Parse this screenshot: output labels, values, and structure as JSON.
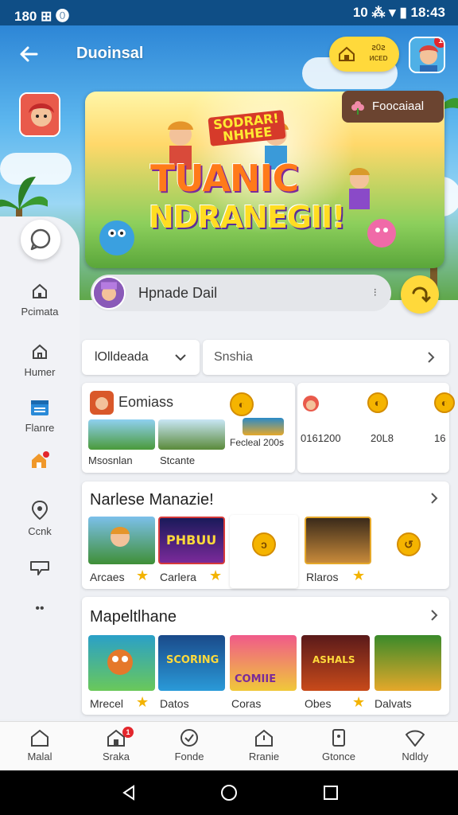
{
  "status_bar": {
    "left": "180 ⊞ ⓿",
    "right": "10 ⁂ ▾ ▮ 18:43"
  },
  "header": {
    "title": "Duoinsal",
    "coins_text": "ꙅ0ꙅ\nᴎᴄᴇᴅ",
    "notification_count": "1"
  },
  "banner": {
    "title": "TUANIC",
    "subtitle": "NDRANEGII!",
    "tag": "SODRAR!\nNHHEE",
    "promo_label": "Foocaiaal"
  },
  "rail": {
    "items": [
      "Pcimata",
      "Humer",
      "Flanre",
      "",
      "Ccnk",
      "",
      "••"
    ]
  },
  "search": {
    "text": "Hpnade Dail",
    "chevron": "⁝"
  },
  "filters": {
    "dropdown": "lOlldeada",
    "search_placeholder": "Snshia"
  },
  "featured": {
    "title": "Eomiass",
    "items": [
      {
        "label": "Msosnlan"
      },
      {
        "label": "Stcante"
      },
      {
        "label": "Fecleal 200ꜱ"
      }
    ],
    "side": {
      "values": [
        "0161200",
        "20L8",
        "16"
      ]
    }
  },
  "section2": {
    "title": "Narlese Manazie!",
    "items": [
      {
        "label": "Arcaes"
      },
      {
        "label": "Carlera"
      },
      {
        "label": ""
      },
      {
        "label": "Rlaros"
      },
      {
        "label": ""
      }
    ]
  },
  "section3": {
    "title": "Mapeltlhane",
    "items": [
      {
        "label": "Mrecel"
      },
      {
        "label": "Datos"
      },
      {
        "label": "Coras"
      },
      {
        "label": "Obes"
      },
      {
        "label": "Dalvats"
      }
    ]
  },
  "bottom_nav": {
    "items": [
      "Malal",
      "Sraka",
      "Fonde",
      "Rranie",
      "Gtonce",
      "Ndldy"
    ],
    "badge": "1"
  },
  "colors": {
    "accent_yellow": "#ffd93b",
    "status_bar": "#0f4e86",
    "badge_red": "#e3262c"
  }
}
